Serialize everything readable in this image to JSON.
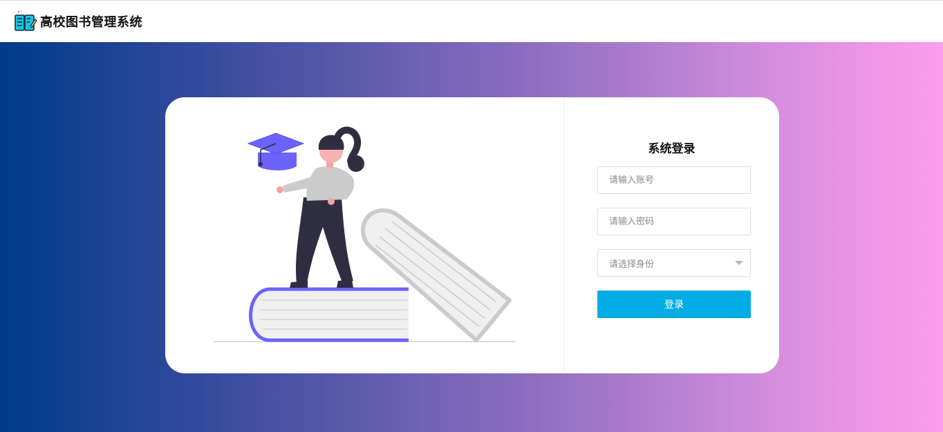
{
  "header": {
    "app_title": "高校图书管理系统",
    "logo_icon": "open-book-pencil-icon"
  },
  "login": {
    "title": "系统登录",
    "account_placeholder": "请输入账号",
    "password_placeholder": "请输入密码",
    "role_placeholder": "请选择身份",
    "submit_label": "登录"
  },
  "colors": {
    "primary_button": "#03ace5",
    "gradient_start": "#003a8a",
    "gradient_end": "#ff9cee",
    "illustration_accent": "#6c63ff"
  },
  "illustration": {
    "icons": [
      "graduation-cap-icon",
      "student-figure",
      "book-stack"
    ]
  }
}
